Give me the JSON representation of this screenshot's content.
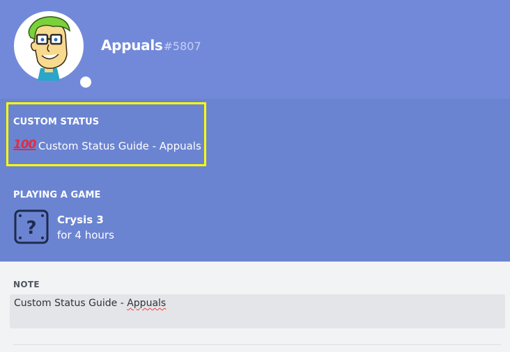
{
  "profile": {
    "username": "Appuals",
    "discriminator": "#5807",
    "status_color": "#ffffff"
  },
  "custom_status": {
    "label": "CUSTOM STATUS",
    "emoji": "100",
    "emoji_icon": "hundred-points-icon",
    "text": "Custom Status Guide - Appuals",
    "highlight_color": "#ffff00"
  },
  "playing": {
    "label": "PLAYING A GAME",
    "game_icon": "unknown-game-icon",
    "game_name": "Crysis 3",
    "duration": "for 4 hours"
  },
  "note": {
    "label": "NOTE",
    "value_prefix": "Custom Status Guide - ",
    "value_misspelled": "Appuals"
  },
  "colors": {
    "header": "#7289da",
    "activity": "#6b84d2",
    "body": "#f2f3f5"
  }
}
